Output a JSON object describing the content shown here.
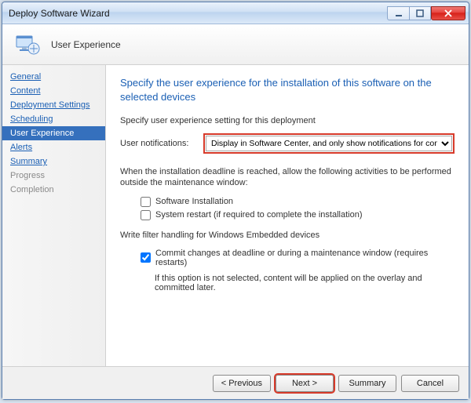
{
  "window": {
    "title": "Deploy Software Wizard"
  },
  "header": {
    "step_title": "User Experience"
  },
  "sidebar": {
    "items": [
      {
        "label": "General",
        "state": "completed"
      },
      {
        "label": "Content",
        "state": "completed"
      },
      {
        "label": "Deployment Settings",
        "state": "completed"
      },
      {
        "label": "Scheduling",
        "state": "completed"
      },
      {
        "label": "User Experience",
        "state": "active"
      },
      {
        "label": "Alerts",
        "state": "completed"
      },
      {
        "label": "Summary",
        "state": "completed"
      },
      {
        "label": "Progress",
        "state": "disabled"
      },
      {
        "label": "Completion",
        "state": "disabled"
      }
    ]
  },
  "main": {
    "heading": "Specify the user experience for the installation of this software on the selected devices",
    "instruction": "Specify user experience setting for this deployment",
    "notifications_label": "User notifications:",
    "notifications_value": "Display in Software Center, and only show notifications for computer restarts",
    "deadline_text": "When the installation deadline is reached, allow the following activities to be performed outside the maintenance window:",
    "checkbox_install": {
      "label": "Software Installation",
      "checked": false
    },
    "checkbox_restart": {
      "label": "System restart  (if required to complete the installation)",
      "checked": false
    },
    "filter_heading": "Write filter handling for Windows Embedded devices",
    "checkbox_commit": {
      "label": "Commit changes at deadline or during a maintenance window (requires restarts)",
      "checked": true
    },
    "commit_note": "If this option is not selected, content will be applied on the overlay and committed later."
  },
  "footer": {
    "previous": "< Previous",
    "next": "Next >",
    "summary": "Summary",
    "cancel": "Cancel"
  }
}
